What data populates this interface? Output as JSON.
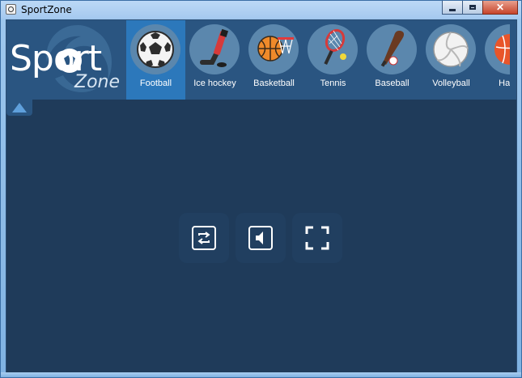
{
  "window": {
    "title": "SportZone",
    "minimize_icon": "minimize-icon",
    "maximize_icon": "maximize-icon",
    "close_label": "✕"
  },
  "logo": {
    "sport": "Sport",
    "zone": "Zone"
  },
  "sports": [
    {
      "label": "Football",
      "icon": "football-icon",
      "selected": true
    },
    {
      "label": "Ice hockey",
      "icon": "hockey-stick-icon",
      "selected": false
    },
    {
      "label": "Basketball",
      "icon": "basketball-icon",
      "selected": false
    },
    {
      "label": "Tennis",
      "icon": "tennis-racket-icon",
      "selected": false
    },
    {
      "label": "Baseball",
      "icon": "baseball-bat-icon",
      "selected": false
    },
    {
      "label": "Volleyball",
      "icon": "volleyball-icon",
      "selected": false
    },
    {
      "label": "Handl",
      "icon": "handball-icon",
      "selected": false
    }
  ],
  "controls": [
    {
      "icon": "repeat-icon"
    },
    {
      "icon": "volume-icon"
    },
    {
      "icon": "fullscreen-icon"
    }
  ],
  "colors": {
    "background": "#1f3b5a",
    "topbar": "#2a5581",
    "selected": "#2c78bb",
    "icon_circle": "#5b87ad",
    "accent": "#5fa0dc"
  }
}
